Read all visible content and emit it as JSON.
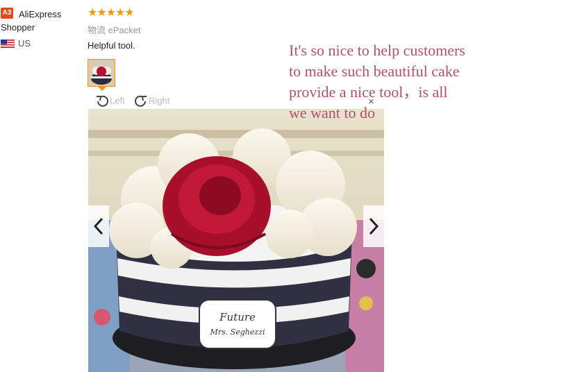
{
  "reviewer": {
    "badge": "A3",
    "name": "AliExpress Shopper",
    "country": "US",
    "flag_icon": "us-flag-icon"
  },
  "review": {
    "rating": 5,
    "stars": "★★★★★",
    "shipping_label_cn": "物流",
    "shipping_method": "ePacket",
    "text": "Helpful tool."
  },
  "viewer": {
    "rotate_left_label": "Left",
    "rotate_right_label": "Right",
    "close_label": "×",
    "prev_icon": "chevron-left-icon",
    "next_icon": "chevron-right-icon",
    "cake_plaque_line1": "Future",
    "cake_plaque_line2": "Mrs. Seghezzi"
  },
  "overlay_text": "It's so nice to help customers\nto make such beautiful cake\nprovide a nice tool，is all\nwe want to do",
  "colors": {
    "accent_orange": "#f19122",
    "star": "#ff9800",
    "overlay_text": "#b0506f",
    "badge": "#e64a19"
  }
}
